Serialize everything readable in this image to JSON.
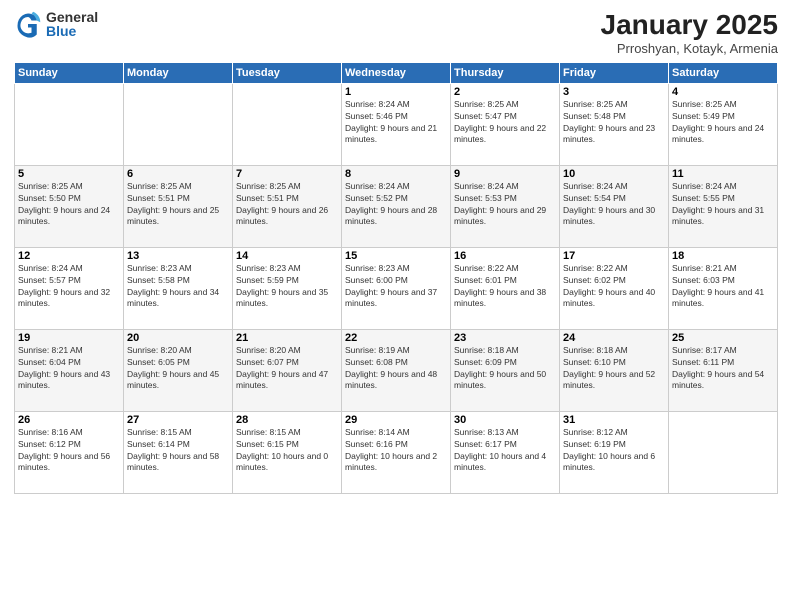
{
  "logo": {
    "general": "General",
    "blue": "Blue"
  },
  "title": "January 2025",
  "subtitle": "Prroshyan, Kotayk, Armenia",
  "headers": [
    "Sunday",
    "Monday",
    "Tuesday",
    "Wednesday",
    "Thursday",
    "Friday",
    "Saturday"
  ],
  "weeks": [
    [
      {
        "day": "",
        "sunrise": "",
        "sunset": "",
        "daylight": ""
      },
      {
        "day": "",
        "sunrise": "",
        "sunset": "",
        "daylight": ""
      },
      {
        "day": "",
        "sunrise": "",
        "sunset": "",
        "daylight": ""
      },
      {
        "day": "1",
        "sunrise": "Sunrise: 8:24 AM",
        "sunset": "Sunset: 5:46 PM",
        "daylight": "Daylight: 9 hours and 21 minutes."
      },
      {
        "day": "2",
        "sunrise": "Sunrise: 8:25 AM",
        "sunset": "Sunset: 5:47 PM",
        "daylight": "Daylight: 9 hours and 22 minutes."
      },
      {
        "day": "3",
        "sunrise": "Sunrise: 8:25 AM",
        "sunset": "Sunset: 5:48 PM",
        "daylight": "Daylight: 9 hours and 23 minutes."
      },
      {
        "day": "4",
        "sunrise": "Sunrise: 8:25 AM",
        "sunset": "Sunset: 5:49 PM",
        "daylight": "Daylight: 9 hours and 24 minutes."
      }
    ],
    [
      {
        "day": "5",
        "sunrise": "Sunrise: 8:25 AM",
        "sunset": "Sunset: 5:50 PM",
        "daylight": "Daylight: 9 hours and 24 minutes."
      },
      {
        "day": "6",
        "sunrise": "Sunrise: 8:25 AM",
        "sunset": "Sunset: 5:51 PM",
        "daylight": "Daylight: 9 hours and 25 minutes."
      },
      {
        "day": "7",
        "sunrise": "Sunrise: 8:25 AM",
        "sunset": "Sunset: 5:51 PM",
        "daylight": "Daylight: 9 hours and 26 minutes."
      },
      {
        "day": "8",
        "sunrise": "Sunrise: 8:24 AM",
        "sunset": "Sunset: 5:52 PM",
        "daylight": "Daylight: 9 hours and 28 minutes."
      },
      {
        "day": "9",
        "sunrise": "Sunrise: 8:24 AM",
        "sunset": "Sunset: 5:53 PM",
        "daylight": "Daylight: 9 hours and 29 minutes."
      },
      {
        "day": "10",
        "sunrise": "Sunrise: 8:24 AM",
        "sunset": "Sunset: 5:54 PM",
        "daylight": "Daylight: 9 hours and 30 minutes."
      },
      {
        "day": "11",
        "sunrise": "Sunrise: 8:24 AM",
        "sunset": "Sunset: 5:55 PM",
        "daylight": "Daylight: 9 hours and 31 minutes."
      }
    ],
    [
      {
        "day": "12",
        "sunrise": "Sunrise: 8:24 AM",
        "sunset": "Sunset: 5:57 PM",
        "daylight": "Daylight: 9 hours and 32 minutes."
      },
      {
        "day": "13",
        "sunrise": "Sunrise: 8:23 AM",
        "sunset": "Sunset: 5:58 PM",
        "daylight": "Daylight: 9 hours and 34 minutes."
      },
      {
        "day": "14",
        "sunrise": "Sunrise: 8:23 AM",
        "sunset": "Sunset: 5:59 PM",
        "daylight": "Daylight: 9 hours and 35 minutes."
      },
      {
        "day": "15",
        "sunrise": "Sunrise: 8:23 AM",
        "sunset": "Sunset: 6:00 PM",
        "daylight": "Daylight: 9 hours and 37 minutes."
      },
      {
        "day": "16",
        "sunrise": "Sunrise: 8:22 AM",
        "sunset": "Sunset: 6:01 PM",
        "daylight": "Daylight: 9 hours and 38 minutes."
      },
      {
        "day": "17",
        "sunrise": "Sunrise: 8:22 AM",
        "sunset": "Sunset: 6:02 PM",
        "daylight": "Daylight: 9 hours and 40 minutes."
      },
      {
        "day": "18",
        "sunrise": "Sunrise: 8:21 AM",
        "sunset": "Sunset: 6:03 PM",
        "daylight": "Daylight: 9 hours and 41 minutes."
      }
    ],
    [
      {
        "day": "19",
        "sunrise": "Sunrise: 8:21 AM",
        "sunset": "Sunset: 6:04 PM",
        "daylight": "Daylight: 9 hours and 43 minutes."
      },
      {
        "day": "20",
        "sunrise": "Sunrise: 8:20 AM",
        "sunset": "Sunset: 6:05 PM",
        "daylight": "Daylight: 9 hours and 45 minutes."
      },
      {
        "day": "21",
        "sunrise": "Sunrise: 8:20 AM",
        "sunset": "Sunset: 6:07 PM",
        "daylight": "Daylight: 9 hours and 47 minutes."
      },
      {
        "day": "22",
        "sunrise": "Sunrise: 8:19 AM",
        "sunset": "Sunset: 6:08 PM",
        "daylight": "Daylight: 9 hours and 48 minutes."
      },
      {
        "day": "23",
        "sunrise": "Sunrise: 8:18 AM",
        "sunset": "Sunset: 6:09 PM",
        "daylight": "Daylight: 9 hours and 50 minutes."
      },
      {
        "day": "24",
        "sunrise": "Sunrise: 8:18 AM",
        "sunset": "Sunset: 6:10 PM",
        "daylight": "Daylight: 9 hours and 52 minutes."
      },
      {
        "day": "25",
        "sunrise": "Sunrise: 8:17 AM",
        "sunset": "Sunset: 6:11 PM",
        "daylight": "Daylight: 9 hours and 54 minutes."
      }
    ],
    [
      {
        "day": "26",
        "sunrise": "Sunrise: 8:16 AM",
        "sunset": "Sunset: 6:12 PM",
        "daylight": "Daylight: 9 hours and 56 minutes."
      },
      {
        "day": "27",
        "sunrise": "Sunrise: 8:15 AM",
        "sunset": "Sunset: 6:14 PM",
        "daylight": "Daylight: 9 hours and 58 minutes."
      },
      {
        "day": "28",
        "sunrise": "Sunrise: 8:15 AM",
        "sunset": "Sunset: 6:15 PM",
        "daylight": "Daylight: 10 hours and 0 minutes."
      },
      {
        "day": "29",
        "sunrise": "Sunrise: 8:14 AM",
        "sunset": "Sunset: 6:16 PM",
        "daylight": "Daylight: 10 hours and 2 minutes."
      },
      {
        "day": "30",
        "sunrise": "Sunrise: 8:13 AM",
        "sunset": "Sunset: 6:17 PM",
        "daylight": "Daylight: 10 hours and 4 minutes."
      },
      {
        "day": "31",
        "sunrise": "Sunrise: 8:12 AM",
        "sunset": "Sunset: 6:19 PM",
        "daylight": "Daylight: 10 hours and 6 minutes."
      },
      {
        "day": "",
        "sunrise": "",
        "sunset": "",
        "daylight": ""
      }
    ]
  ]
}
